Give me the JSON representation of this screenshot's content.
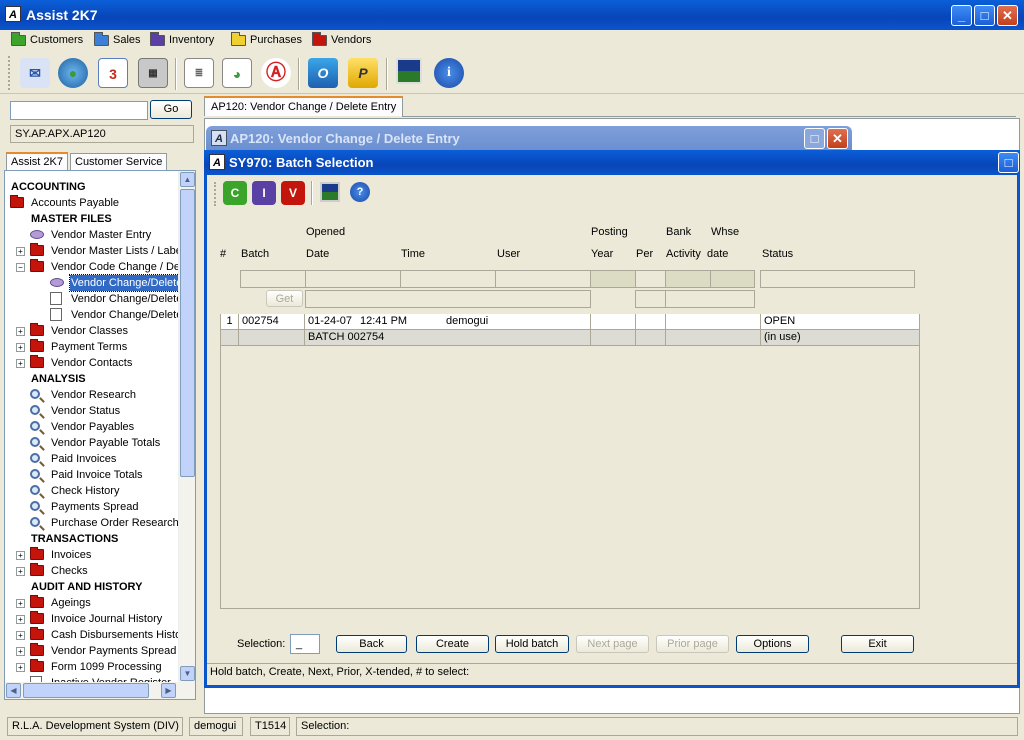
{
  "window": {
    "title": "Assist 2K7",
    "logo_text": "A"
  },
  "menu": {
    "items": [
      {
        "label": "Customers",
        "color": "#3aa52a"
      },
      {
        "label": "Sales",
        "color": "#3b7fd9"
      },
      {
        "label": "Inventory",
        "color": "#5a3fa5"
      },
      {
        "label": "Purchases",
        "color": "#f0d030"
      },
      {
        "label": "Vendors",
        "color": "#c4150c"
      }
    ]
  },
  "toolbar": {
    "tools": [
      "mail-icon",
      "globe-icon",
      "calendar-icon",
      "calculator-icon",
      "document-icon",
      "report-chart-icon",
      "acrobat-icon",
      "outlook-icon",
      "publisher-icon",
      "image-icon",
      "info-icon"
    ],
    "calendar_text": "3"
  },
  "left": {
    "search_value": "",
    "go_label": "Go",
    "path": "SY.AP.APX.AP120",
    "tabs": [
      "Assist 2K7",
      "Customer Service"
    ],
    "tree": [
      {
        "label": "ACCOUNTING",
        "type": "head",
        "indent": 0
      },
      {
        "label": "Accounts Payable",
        "type": "folder",
        "indent": 0
      },
      {
        "label": "MASTER FILES",
        "type": "head",
        "indent": 1
      },
      {
        "label": "Vendor Master Entry",
        "type": "gem",
        "indent": 1
      },
      {
        "label": "Vendor Master Lists / Labels",
        "type": "folder",
        "indent": 1,
        "expander": "+"
      },
      {
        "label": "Vendor Code Change / Delete",
        "type": "folder",
        "indent": 1,
        "expander": "-"
      },
      {
        "label": "Vendor Change/Delete",
        "type": "gem",
        "indent": 2,
        "selected": true
      },
      {
        "label": "Vendor Change/Delete",
        "type": "doc",
        "indent": 2
      },
      {
        "label": "Vendor Change/Delete",
        "type": "doc",
        "indent": 2
      },
      {
        "label": "Vendor Classes",
        "type": "folder",
        "indent": 1,
        "expander": "+"
      },
      {
        "label": "Payment Terms",
        "type": "folder",
        "indent": 1,
        "expander": "+"
      },
      {
        "label": "Vendor Contacts",
        "type": "folder",
        "indent": 1,
        "expander": "+"
      },
      {
        "label": "ANALYSIS",
        "type": "head",
        "indent": 1
      },
      {
        "label": "Vendor Research",
        "type": "mag",
        "indent": 1
      },
      {
        "label": "Vendor Status",
        "type": "mag",
        "indent": 1
      },
      {
        "label": "Vendor Payables",
        "type": "mag",
        "indent": 1
      },
      {
        "label": "Vendor Payable Totals",
        "type": "mag",
        "indent": 1
      },
      {
        "label": "Paid Invoices",
        "type": "mag",
        "indent": 1
      },
      {
        "label": "Paid Invoice Totals",
        "type": "mag",
        "indent": 1
      },
      {
        "label": "Check History",
        "type": "mag",
        "indent": 1
      },
      {
        "label": "Payments Spread",
        "type": "mag",
        "indent": 1
      },
      {
        "label": "Purchase Order Research",
        "type": "mag",
        "indent": 1
      },
      {
        "label": "TRANSACTIONS",
        "type": "head",
        "indent": 1
      },
      {
        "label": "Invoices",
        "type": "folder",
        "indent": 1,
        "expander": "+"
      },
      {
        "label": "Checks",
        "type": "folder",
        "indent": 1,
        "expander": "+"
      },
      {
        "label": "AUDIT AND HISTORY",
        "type": "head",
        "indent": 1
      },
      {
        "label": "Ageings",
        "type": "folder",
        "indent": 1,
        "expander": "+"
      },
      {
        "label": "Invoice Journal History",
        "type": "folder",
        "indent": 1,
        "expander": "+"
      },
      {
        "label": "Cash Disbursements History",
        "type": "folder",
        "indent": 1,
        "expander": "+"
      },
      {
        "label": "Vendor Payments Spread Report",
        "type": "folder",
        "indent": 1,
        "expander": "+"
      },
      {
        "label": "Form 1099 Processing",
        "type": "folder",
        "indent": 1,
        "expander": "+"
      },
      {
        "label": "Inactive Vendor Register",
        "type": "doc",
        "indent": 1
      }
    ]
  },
  "doc_tab": "AP120: Vendor Change / Delete Entry",
  "ap120_title": "AP120: Vendor Change / Delete Entry",
  "sy970": {
    "title": "SY970: Batch Selection",
    "icons": [
      "create-batch-icon",
      "info-batch-icon",
      "view-batch-icon",
      "image-icon",
      "help-icon"
    ],
    "icon_letters": [
      "C",
      "I",
      "V"
    ],
    "headers_top": {
      "opened": "Opened",
      "posting": "Posting",
      "bank": "Bank",
      "whse": "Whse"
    },
    "headers": {
      "num": "#",
      "batch": "Batch",
      "date": "Date",
      "time": "Time",
      "user": "User",
      "year": "Year",
      "per": "Per",
      "activity": "Activity",
      "wdate": "date",
      "status": "Status"
    },
    "get_label": "Get",
    "rows": [
      {
        "num": "1",
        "batch": "002754",
        "date": "01-24-07",
        "time": "12:41 PM",
        "user": "demogui",
        "status": "OPEN"
      },
      {
        "num": "",
        "batch": "",
        "date": "BATCH 002754",
        "time": "",
        "user": "",
        "status": "(in use)"
      }
    ],
    "selection_label": "Selection:",
    "selection_value": "_",
    "buttons": {
      "back": "Back",
      "create": "Create",
      "hold": "Hold batch",
      "next": "Next page",
      "prior": "Prior page",
      "options": "Options",
      "exit": "Exit"
    },
    "hint": "Hold batch,  Create,  Next,  Prior,  X-tended,  # to select:"
  },
  "statusbar": {
    "system": "R.L.A. Development System (DIV)",
    "user": "demogui",
    "terminal": "T1514",
    "selection": "Selection:"
  }
}
